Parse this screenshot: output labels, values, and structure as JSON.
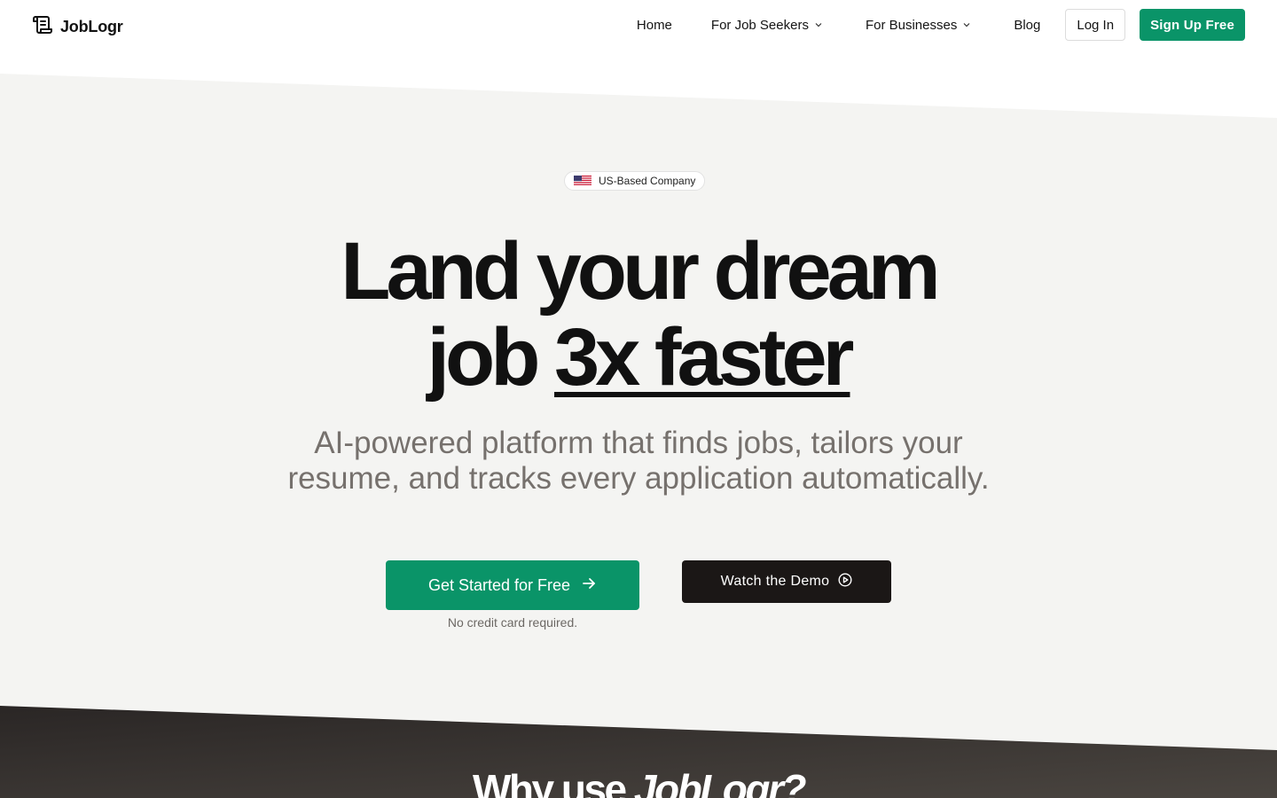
{
  "nav": {
    "brand": "JobLogr",
    "links": [
      {
        "label": "Home"
      },
      {
        "label": "For Job Seekers"
      },
      {
        "label": "For Businesses"
      },
      {
        "label": "Blog"
      }
    ],
    "login_label": "Log In",
    "signup_label": "Sign Up Free"
  },
  "hero": {
    "badge": "US-Based Company",
    "headline_line1": "Land your dream",
    "headline_line2_prefix": "job ",
    "headline_line2_emphasis": "3x faster",
    "subheadline_line1": "AI-powered platform that finds jobs, tailors your",
    "subheadline_line2": "resume, and tracks every application automatically.",
    "cta_primary": "Get Started for Free",
    "cta_note": "No credit card required.",
    "cta_secondary": "Watch the Demo"
  },
  "next_section": {
    "heading_prefix": "Why use ",
    "heading_brand": "JobLogr?"
  },
  "colors": {
    "accent": "#0a9468",
    "dark": "#1b1716",
    "hero_bg": "#f4f4f2",
    "muted_text": "#76716d"
  },
  "icons": {
    "logo": "scroll-icon",
    "dropdown": "chevron-down-icon",
    "cta_primary": "arrow-right-icon",
    "cta_secondary": "play-circle-icon",
    "badge": "us-flag-icon"
  }
}
